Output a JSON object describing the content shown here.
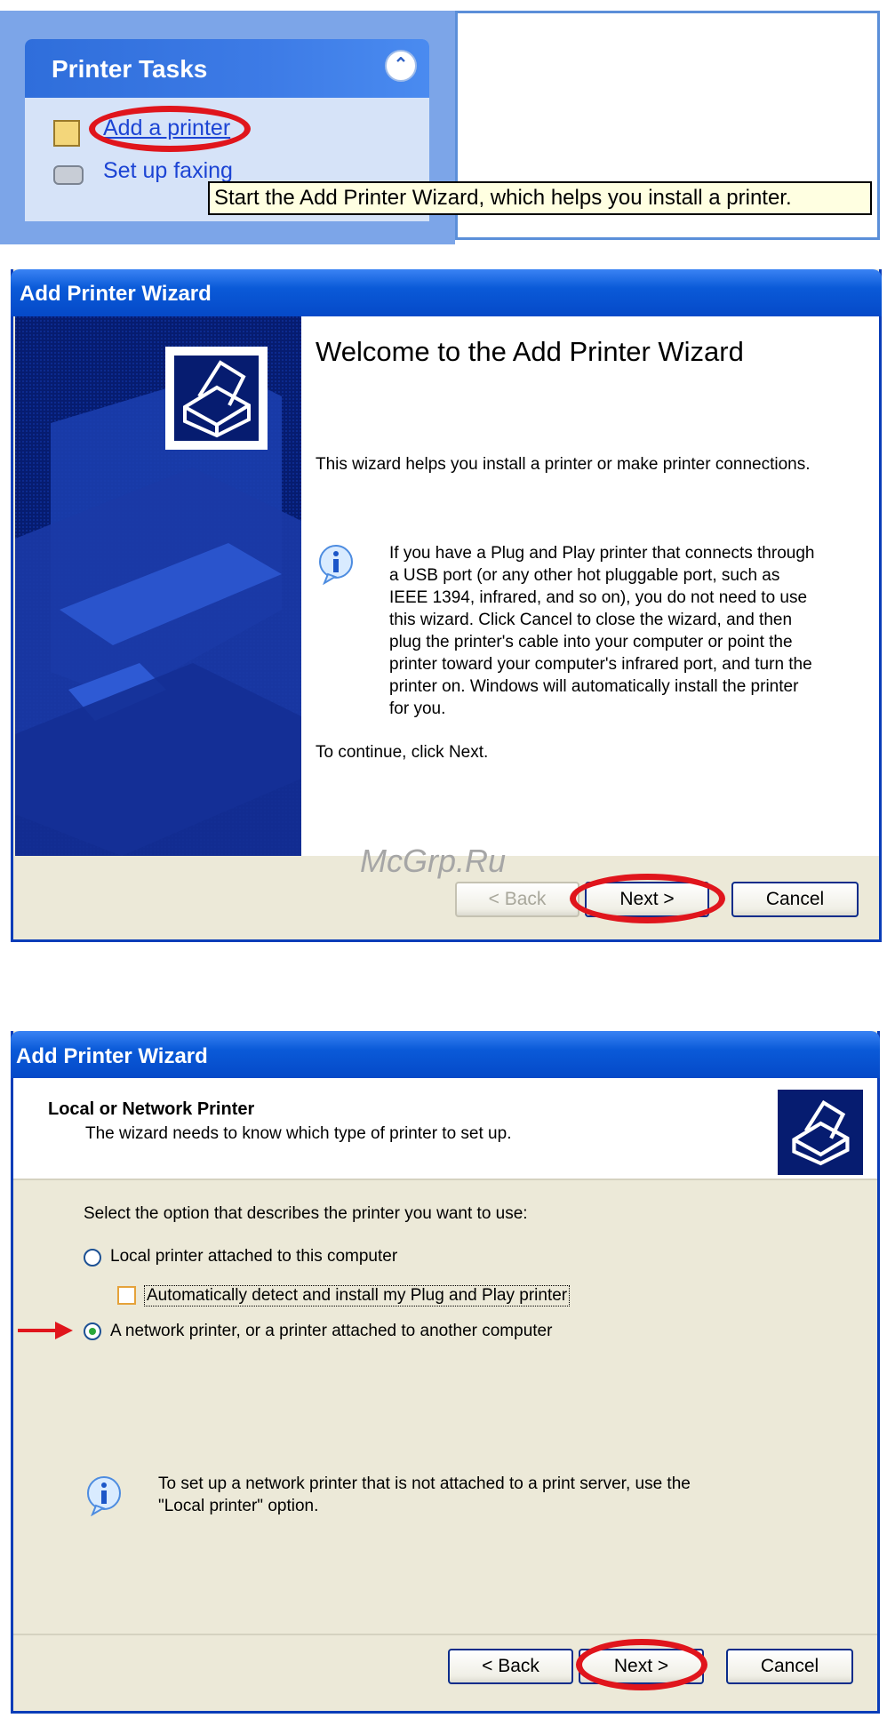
{
  "printer_tasks": {
    "title": "Printer Tasks",
    "add_printer": "Add a printer",
    "setup_faxing": "Set up faxing",
    "tooltip": "Start the Add Printer Wizard, which helps you install a printer."
  },
  "wizard1": {
    "window_title": "Add Printer Wizard",
    "heading": "Welcome to the Add Printer Wizard",
    "intro": "This wizard helps you install a printer or make printer connections.",
    "info": "If you have a Plug and Play printer that connects through a USB port (or any other hot pluggable port, such as IEEE 1394, infrared, and so on), you do not need to use this wizard. Click Cancel to close the wizard, and then plug the printer's cable into your computer or point the printer toward your computer's infrared port, and turn the printer on. Windows will automatically install the printer for you.",
    "continue_text": "To continue, click Next.",
    "back_label": "< Back",
    "next_label": "Next >",
    "cancel_label": "Cancel"
  },
  "watermark": "McGrp.Ru",
  "wizard2": {
    "window_title": "Add Printer Wizard",
    "header_title": "Local or Network Printer",
    "header_subtitle": "The wizard needs to know which type of printer to set up.",
    "prompt": "Select the option that describes the printer you want to use:",
    "option_local": "Local printer attached to this computer",
    "option_autodetect": "Automatically detect and install my Plug and Play printer",
    "option_network": "A network printer, or a printer attached to another computer",
    "selected_option": "network",
    "autodetect_checked": false,
    "info": "To set up a network printer that is not attached to a print server, use the \"Local printer\" option.",
    "back_label": "< Back",
    "next_label": "Next >",
    "cancel_label": "Cancel"
  },
  "colors": {
    "xp_title_blue": "#0a5ad8",
    "wizard_bg": "#ece9d8",
    "highlight_red": "#e0151c",
    "link_blue": "#1c44d4"
  }
}
